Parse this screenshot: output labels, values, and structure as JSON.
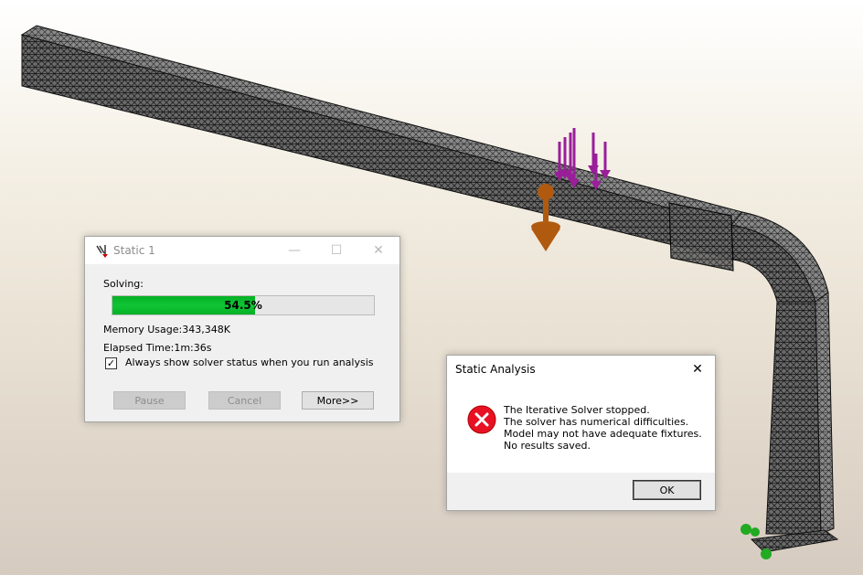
{
  "solver_window": {
    "title": "Static 1",
    "solving_label": "Solving:",
    "progress_percent": 54.5,
    "progress_text": "54.5%",
    "memory_label": "Memory Usage:",
    "memory_value": "343,348K",
    "elapsed_label": "Elapsed Time:",
    "elapsed_value": "1m:36s",
    "always_show_label": "Always show solver status when you run analysis",
    "always_show_checked": true,
    "pause_label": "Pause",
    "cancel_label": "Cancel",
    "more_label": "More>>"
  },
  "error_dialog": {
    "title": "Static Analysis",
    "close_glyph": "✕",
    "message_lines": [
      "The Iterative Solver stopped.",
      "The solver has numerical difficulties.",
      "Model may not have adequate fixtures.",
      "No results saved."
    ],
    "ok_label": "OK"
  },
  "colors": {
    "load_arrow": "#9a1e9a",
    "fixture": "#b05a10",
    "foot_fixture": "#22aa22",
    "mesh": "#2a2a2a",
    "progress": "#06b025",
    "error_icon": "#e81123"
  }
}
